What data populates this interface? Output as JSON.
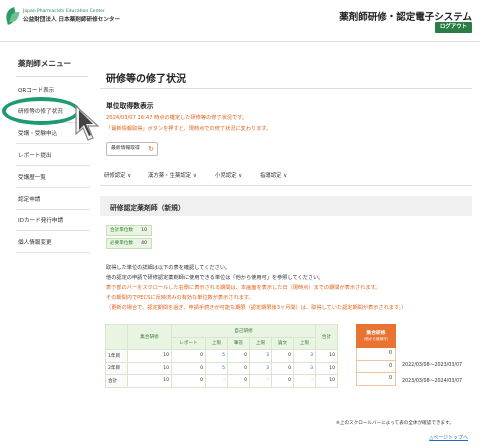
{
  "header": {
    "org_en": "Japan Pharmacists Education Center",
    "org_jp": "公益財団法人 日本薬剤師研修センター",
    "system_title": "薬剤師研修・認定電子システム",
    "logout_label": "ログアウト",
    "colors": {
      "brand_green": "#2a7d45"
    }
  },
  "sidebar": {
    "title": "薬剤師メニュー",
    "items": [
      {
        "label": "QRコード表示"
      },
      {
        "label": "研修等の修了状況"
      },
      {
        "label": "受講・受験申込"
      },
      {
        "label": "レポート提出"
      },
      {
        "label": "受講歴一覧"
      },
      {
        "label": "認定申請"
      },
      {
        "label": "IDカード発行申請"
      },
      {
        "label": "個人情報変更"
      }
    ]
  },
  "main": {
    "page_title": "研修等の修了状況",
    "unit_section_title": "単位取得数表示",
    "notice_line1": "2024/03/07 16:47 時点の確定した研修等の修了状況です。",
    "notice_line2": "「最新情報取得」ボタンを押すと、現時点での修了状況に変わります。",
    "refresh_label": "最新情報取得",
    "filters": [
      {
        "label": "研修認定 ∨"
      },
      {
        "label": "漢方薬・生薬認定 ∨"
      },
      {
        "label": "小児認定 ∨"
      },
      {
        "label": "指導認定 ∨"
      }
    ],
    "section_title": "研修認定薬剤師（新規）",
    "units": {
      "total_label": "合計単位数",
      "total_value": "10",
      "required_label": "必要単位数",
      "required_value": "40"
    },
    "info_lines": [
      {
        "text": "取得した単位の詳細は以下の表を確認してください。",
        "color": "black"
      },
      {
        "text": "他の認定の申請で研修認定薬剤師に使用できる単位は「他から使用可」を参照してください。",
        "color": "black"
      },
      {
        "text": "表下部のバーをスクロールした右側に表示される期間は、本画面を表示した日（現時点）までの期間が表示されます。",
        "color": "orange"
      },
      {
        "text": "その期間内でPECSに反映済みの有効な単位数が表示されます。",
        "color": "orange"
      },
      {
        "text": "（更新の場合で、認定期間を過ぎ、申請手続きが可能な期限（認定期限後3ヶ月間）は、取得していた認定期間が表示されます。）",
        "color": "orange"
      }
    ],
    "table": {
      "col_group": "集合研修",
      "col_self": "自己研修",
      "col_total": "合計",
      "sub_report": "レポート",
      "sub_limit": "上限",
      "sub_test": "筆答",
      "sub_limit2": "上限",
      "sub_other": "論文",
      "sub_limit3": "上限",
      "rows": [
        {
          "label": "1年目",
          "group": "10",
          "report": "0",
          "limit1": "5",
          "test": "0",
          "limit2": "3",
          "other": "0",
          "limit3": "3",
          "total": "10"
        },
        {
          "label": "2年目",
          "group": "10",
          "report": "0",
          "limit1": "5",
          "test": "0",
          "limit2": "3",
          "other": "0",
          "limit3": "3",
          "total": "10"
        },
        {
          "label": "合計",
          "group": "10",
          "report": "0",
          "limit1": "-",
          "test": "0",
          "limit2": "-",
          "other": "0",
          "limit3": "-",
          "total": "10"
        }
      ],
      "orange_header": "集合研修",
      "orange_header_sub": "(他から使用可)",
      "orange_values": [
        "0",
        "0",
        "0"
      ],
      "periods": [
        "2022/03/08〜2023/03/07",
        "2023/03/08〜2024/03/07"
      ]
    },
    "scroll_note": "※上のスクロールバーによって表の全体が確認できます。",
    "to_top": "△ページトップへ"
  }
}
